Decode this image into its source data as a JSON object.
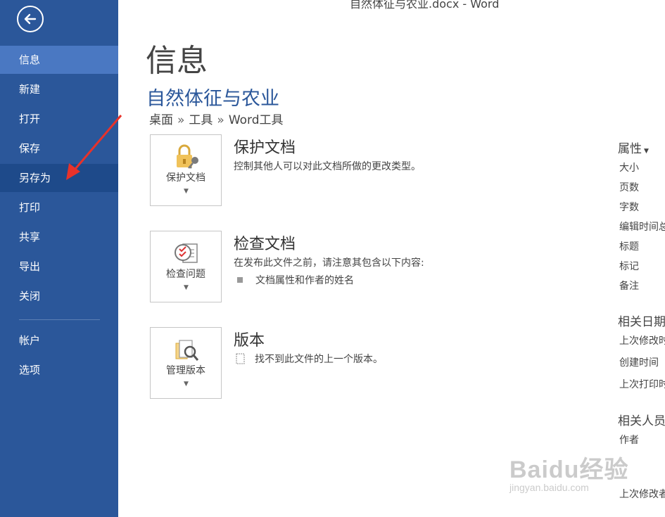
{
  "window": {
    "title": "自然体征与农业.docx - Word"
  },
  "sidebar": {
    "items": [
      {
        "label": "信息"
      },
      {
        "label": "新建"
      },
      {
        "label": "打开"
      },
      {
        "label": "保存"
      },
      {
        "label": "另存为"
      },
      {
        "label": "打印"
      },
      {
        "label": "共享"
      },
      {
        "label": "导出"
      },
      {
        "label": "关闭"
      },
      {
        "label": "帐户"
      },
      {
        "label": "选项"
      }
    ],
    "active": "信息",
    "bg_color": "#2b579a",
    "active_color": "#4a78c2"
  },
  "main": {
    "page_title": "信息",
    "doc_title": "自然体征与农业",
    "breadcrumb": [
      "桌面",
      "工具",
      "Word工具"
    ],
    "breadcrumb_sep": "»",
    "sections": [
      {
        "button_label": "保护文档",
        "heading": "保护文档",
        "description": "控制其他人可以对此文档所做的更改类型。"
      },
      {
        "button_label": "检查问题",
        "heading": "检查文档",
        "description": "在发布此文件之前，请注意其包含以下内容:",
        "bullets": [
          "文档属性和作者的姓名"
        ]
      },
      {
        "button_label": "管理版本",
        "heading": "版本",
        "description": "找不到此文件的上一个版本。"
      }
    ]
  },
  "properties": {
    "heading": "属性",
    "items": [
      "大小",
      "页数",
      "字数",
      "编辑时间总",
      "标题",
      "标记",
      "备注"
    ],
    "dates_heading": "相关日期",
    "dates": [
      "上次修改时",
      "创建时间",
      "上次打印时"
    ],
    "people_heading": "相关人员",
    "people": [
      "作者"
    ],
    "last_modified_by": "上次修改者"
  },
  "watermark": {
    "main": "Baidu经验",
    "sub": "jingyan.baidu.com"
  },
  "accent_color": "#2b579a",
  "annotation_arrow_color": "#e8322a"
}
